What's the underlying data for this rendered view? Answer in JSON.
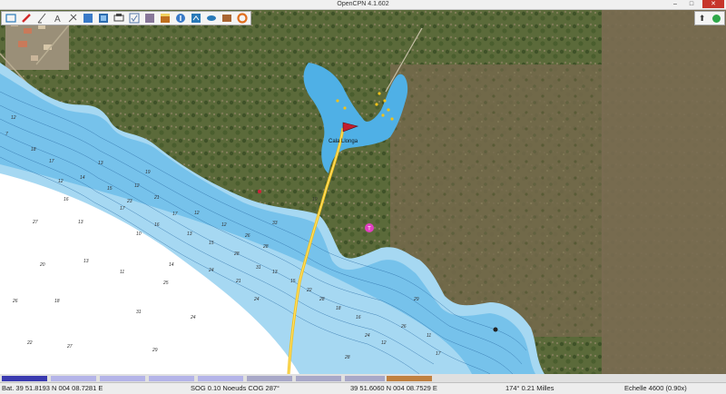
{
  "window": {
    "title": "OpenCPN 4.1.602"
  },
  "toolbar": {
    "items": [
      {
        "icon": "connect-icon",
        "color": "#2a7ab8"
      },
      {
        "icon": "route-icon",
        "color": "#d22a2a"
      },
      {
        "icon": "measure-icon",
        "color": "#555555"
      },
      {
        "icon": "text-icon",
        "color": "#555555"
      },
      {
        "icon": "settings-icon",
        "color": "#555555"
      },
      {
        "icon": "chart-icon",
        "color": "#3a7ac8"
      },
      {
        "icon": "layers-icon",
        "color": "#2e6db0"
      },
      {
        "icon": "print-icon",
        "color": "#444444"
      },
      {
        "icon": "wizard-icon",
        "color": "#5577aa"
      },
      {
        "icon": "image-icon",
        "color": "#887799"
      },
      {
        "icon": "tide-icon",
        "color": "#c07020"
      },
      {
        "icon": "info-icon",
        "color": "#3a7ac8"
      },
      {
        "icon": "track-icon",
        "color": "#2a7ab8"
      },
      {
        "icon": "ais-icon",
        "color": "#2a7ab8"
      },
      {
        "icon": "mob-icon",
        "color": "#aa6633"
      },
      {
        "icon": "lifebuoy-icon",
        "color": "#e07020"
      }
    ]
  },
  "chart": {
    "place_name": "Cala Llonga",
    "depths": [
      "7",
      "12",
      "18",
      "17",
      "12",
      "16",
      "14",
      "13",
      "15",
      "23",
      "12",
      "19",
      "27",
      "13",
      "20",
      "13",
      "11",
      "17",
      "10",
      "21",
      "16",
      "14",
      "17",
      "13",
      "12",
      "15",
      "12",
      "28",
      "26",
      "31",
      "28",
      "33",
      "25",
      "24",
      "31",
      "29",
      "27",
      "22",
      "18",
      "26",
      "24",
      "21",
      "24",
      "13",
      "15",
      "22",
      "28",
      "18",
      "16",
      "24",
      "12",
      "26",
      "29",
      "11",
      "17",
      "28",
      "19"
    ]
  },
  "status": {
    "boat_position": "Bat. 39 51.8193 N   004 08.7281 E",
    "sog_cog": "SOG 0.10 Noeuds   COG 287°",
    "cursor_position": "39 51.6060 N   004 08.7529 E",
    "bearing_distance": "174°  0.21 Milles",
    "scale": "Echelle 4600 (0.90x)"
  },
  "piano": {
    "colors": [
      "#3a3ab0",
      "#b4b4e8",
      "#a8a8c8",
      "#c08040"
    ]
  }
}
